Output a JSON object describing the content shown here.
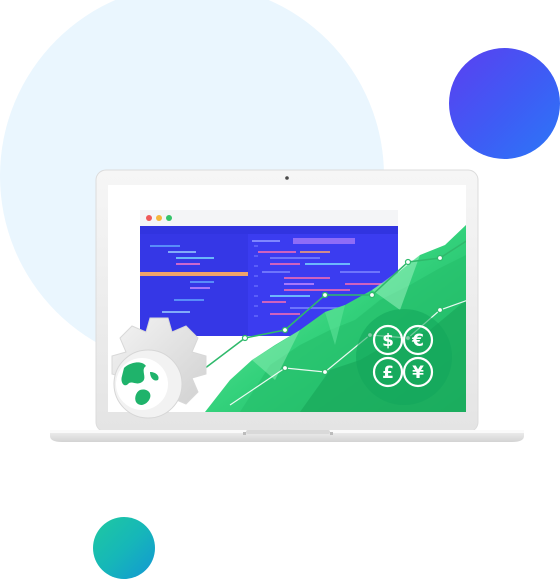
{
  "scene": {
    "colors": {
      "background_circle": "#eaf6fe",
      "accent_blue_ball": "#4d4cf2",
      "accent_teal_ball": "#17b5b7",
      "code_panel": "#3d3df0",
      "chart_green": "#2fcf74",
      "laptop_frame": "#eeeeee"
    },
    "icons": {
      "globe": "globe-gear-icon",
      "currency": "currency-exchange-icon"
    },
    "currency_symbols": [
      "$",
      "€",
      "£",
      "¥"
    ]
  }
}
